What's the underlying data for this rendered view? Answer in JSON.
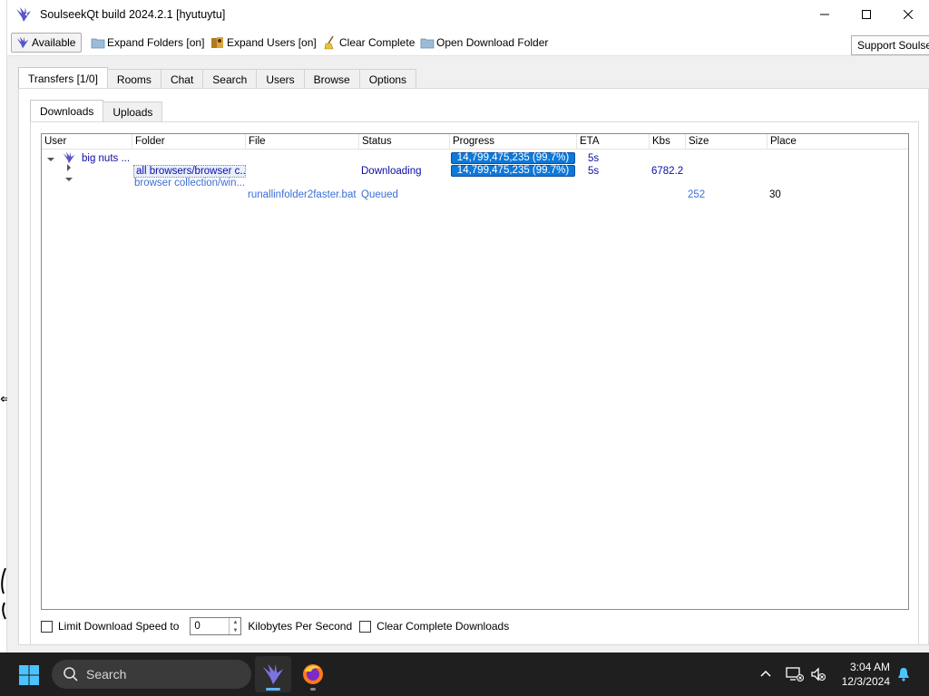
{
  "window": {
    "title": "SoulseekQt build 2024.2.1 [hyutuytu]"
  },
  "toolbar": {
    "available_label": "Available",
    "expand_folders_label": "Expand Folders [on]",
    "expand_users_label": "Expand Users [on]",
    "clear_complete_label": "Clear Complete",
    "open_download_folder_label": "Open Download Folder",
    "support_label": "Support Soulseek"
  },
  "main_tabs": [
    "Transfers [1/0]",
    "Rooms",
    "Chat",
    "Search",
    "Users",
    "Browse",
    "Options"
  ],
  "sub_tabs": [
    "Downloads",
    "Uploads"
  ],
  "table": {
    "columns": [
      "User",
      "Folder",
      "File",
      "Status",
      "Progress",
      "ETA",
      "Kbs",
      "Size",
      "Place"
    ],
    "rows": [
      {
        "user": "big nuts ...",
        "folder": "",
        "file": "",
        "status": "",
        "progress": "14,799,475,235 (99.7%)",
        "progress_fraction": 0.997,
        "eta": "5s",
        "kbs": "",
        "size": "",
        "place": ""
      },
      {
        "user": "",
        "folder": "all browsers/browser c...",
        "file": "",
        "status": "Downloading",
        "progress": "14,799,475,235 (99.7%)",
        "progress_fraction": 0.997,
        "eta": "5s",
        "kbs": "6782.2",
        "size": "",
        "place": ""
      },
      {
        "user": "",
        "folder": "browser collection/win...",
        "file": "",
        "status": "",
        "progress": "",
        "eta": "",
        "kbs": "",
        "size": "",
        "place": ""
      },
      {
        "user": "",
        "folder": "",
        "file": "runallinfolder2faster.bat",
        "status": "Queued",
        "progress": "",
        "eta": "",
        "kbs": "",
        "size": "252",
        "place": "30"
      }
    ]
  },
  "footer": {
    "limit_speed_label": "Limit Download Speed to",
    "limit_speed_checked": false,
    "speed_value": "0",
    "units_label": "Kilobytes Per Second",
    "clear_complete_downloads_label": "Clear Complete Downloads",
    "clear_complete_downloads_checked": false
  },
  "taskbar": {
    "search_placeholder": "Search",
    "time": "3:04 AM",
    "date": "12/3/2024"
  },
  "colors": {
    "progress_fill": "#0e78d8",
    "link_text": "#0c0ca8",
    "taskbar_bg": "#1f1f1f"
  }
}
